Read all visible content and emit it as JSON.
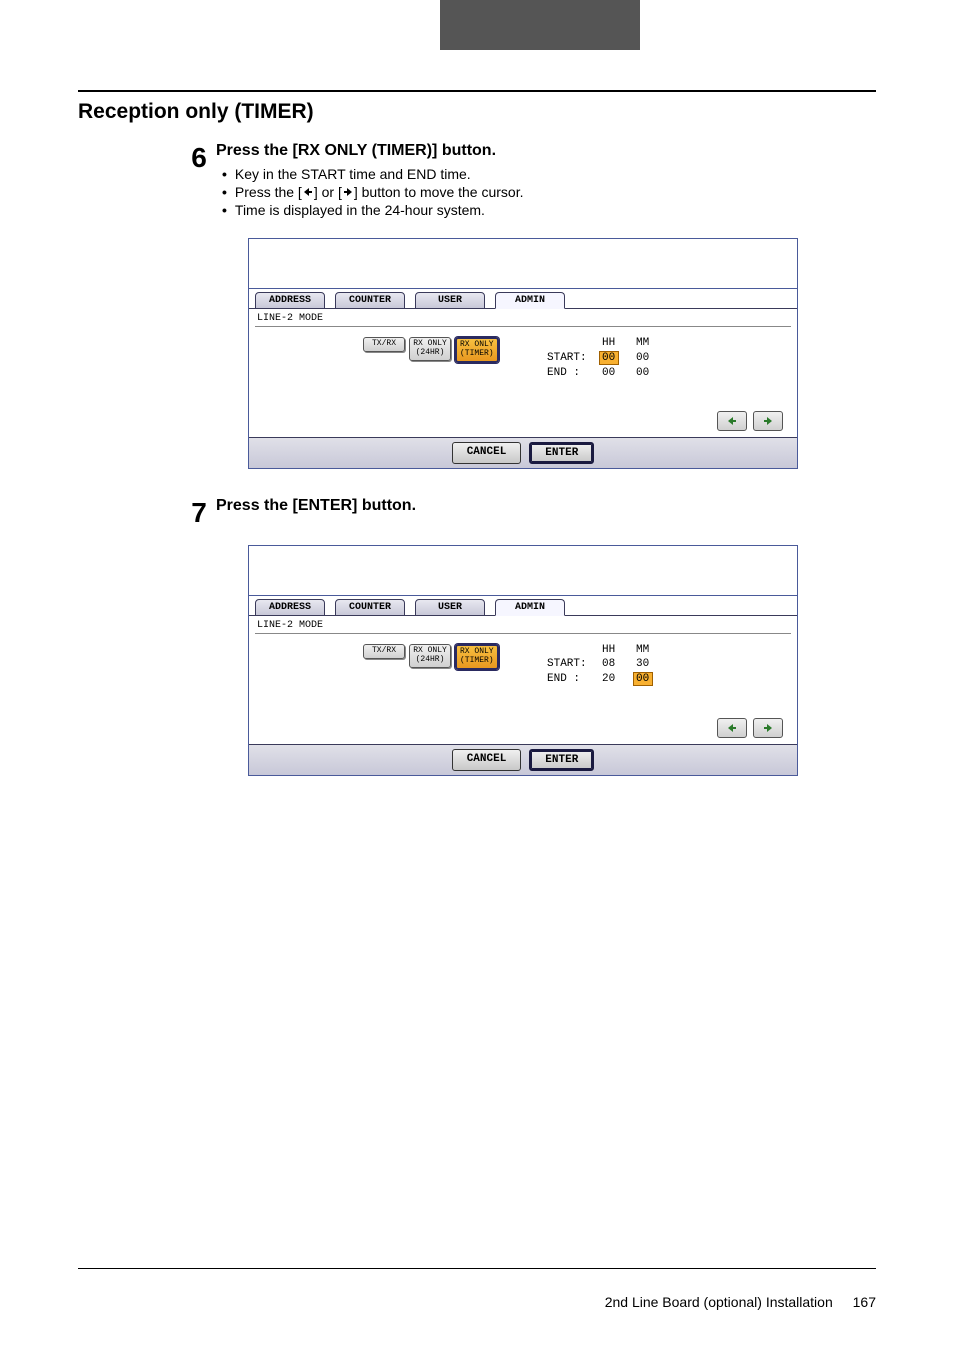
{
  "section_title": "Reception only (TIMER)",
  "steps": [
    {
      "num": "6",
      "heading": "Press the [RX ONLY (TIMER)] button.",
      "bullets": [
        {
          "pre": "Key in the START time and END time.",
          "post": "",
          "arrow": null
        },
        {
          "pre": "Press the [",
          "mid": "] or [",
          "post": "] button to move the cursor.",
          "arrow": "both"
        },
        {
          "pre": "Time is displayed in the 24-hour system.",
          "post": "",
          "arrow": null
        }
      ],
      "panel": {
        "tabs": [
          "ADDRESS",
          "COUNTER",
          "USER",
          "ADMIN"
        ],
        "active_tab": 3,
        "mode_label": "LINE-2 MODE",
        "buttons": [
          {
            "l1": "TX/RX",
            "l2": "",
            "sel": false
          },
          {
            "l1": "RX ONLY",
            "l2": "(24HR)",
            "sel": false
          },
          {
            "l1": "RX ONLY",
            "l2": "(TIMER)",
            "sel": true
          }
        ],
        "time": {
          "hh_label": "HH",
          "mm_label": "MM",
          "start_label": "START:",
          "end_label": "END  :",
          "start_hh": "00",
          "start_hh_hl": true,
          "start_mm": "00",
          "start_mm_hl": false,
          "end_hh": "00",
          "end_hh_hl": false,
          "end_mm": "00",
          "end_mm_hl": false
        },
        "footer": {
          "cancel": "CANCEL",
          "enter": "ENTER"
        }
      }
    },
    {
      "num": "7",
      "heading": "Press the [ENTER] button.",
      "bullets": [],
      "panel": {
        "tabs": [
          "ADDRESS",
          "COUNTER",
          "USER",
          "ADMIN"
        ],
        "active_tab": 3,
        "mode_label": "LINE-2 MODE",
        "buttons": [
          {
            "l1": "TX/RX",
            "l2": "",
            "sel": false
          },
          {
            "l1": "RX ONLY",
            "l2": "(24HR)",
            "sel": false
          },
          {
            "l1": "RX ONLY",
            "l2": "(TIMER)",
            "sel": true
          }
        ],
        "time": {
          "hh_label": "HH",
          "mm_label": "MM",
          "start_label": "START:",
          "end_label": "END  :",
          "start_hh": "08",
          "start_hh_hl": false,
          "start_mm": "30",
          "start_mm_hl": false,
          "end_hh": "20",
          "end_hh_hl": false,
          "end_mm": "00",
          "end_mm_hl": true
        },
        "footer": {
          "cancel": "CANCEL",
          "enter": "ENTER"
        }
      }
    }
  ],
  "footer_text": "2nd Line Board (optional) Installation",
  "page_number": "167"
}
